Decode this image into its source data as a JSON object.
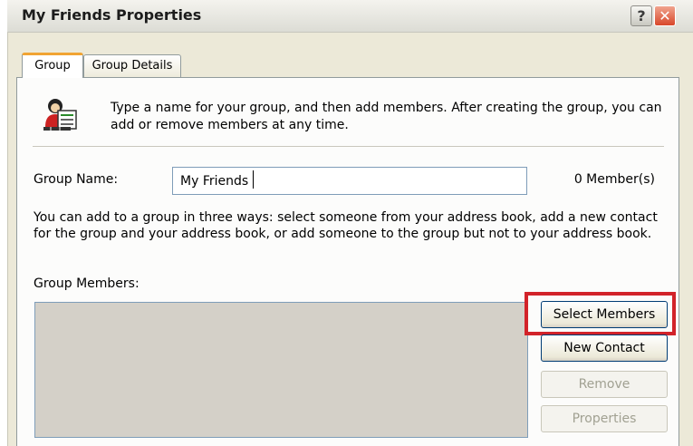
{
  "window": {
    "title": "My Friends Properties",
    "help_label": "?",
    "close_label": "✕"
  },
  "tabs": [
    {
      "label": "Group",
      "active": true
    },
    {
      "label": "Group Details",
      "active": false
    }
  ],
  "group": {
    "intro_text": "Type a name for your group, and then add members. After creating the group, you can add or remove members at any time.",
    "name_label": "Group Name:",
    "name_value": "My Friends",
    "member_count": "0 Member(s)",
    "help_text": "You can add to a group in three ways: select someone from your address book, add a new contact for the group and your address book, or add someone to the group but not to your address book.",
    "members_label": "Group Members:",
    "members": []
  },
  "buttons": {
    "select_members": "Select Members",
    "new_contact": "New Contact",
    "remove": "Remove",
    "properties": "Properties"
  },
  "icons": {
    "group_icon": "group-people-icon",
    "highlight_color": "#d2232a"
  }
}
